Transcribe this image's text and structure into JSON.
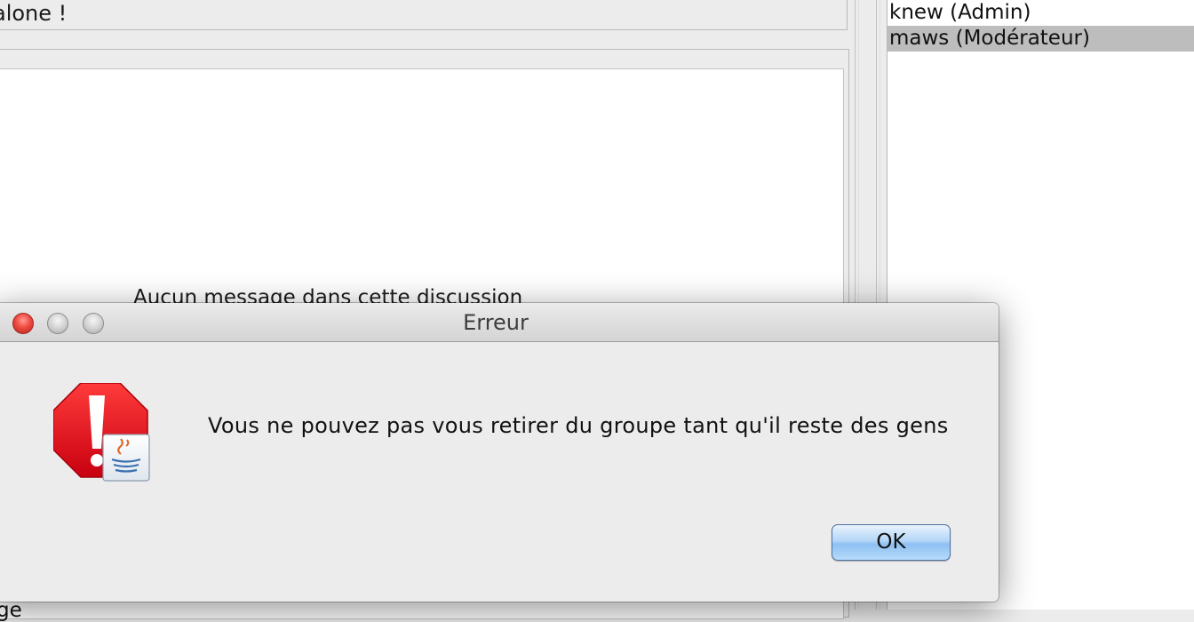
{
  "window": {
    "header_text": "alone !",
    "empty_message": "Aucun message dans cette discussion",
    "bottom_clipped_text": "ge"
  },
  "user_list": {
    "items": [
      {
        "label": "knew (Admin)",
        "selected": false
      },
      {
        "label": "maws (Modérateur)",
        "selected": true
      }
    ]
  },
  "dialog": {
    "title": "Erreur",
    "message": "Vous ne pouvez pas vous retirer du groupe tant qu'il reste des gens",
    "ok_label": "OK",
    "icon": "error-stop-icon",
    "badge_icon": "java-icon"
  },
  "colors": {
    "close_button": "#ee4a40",
    "ok_button": "#8ec0f2",
    "selection": "#bdbdbd",
    "error_icon": "#e4000f"
  }
}
